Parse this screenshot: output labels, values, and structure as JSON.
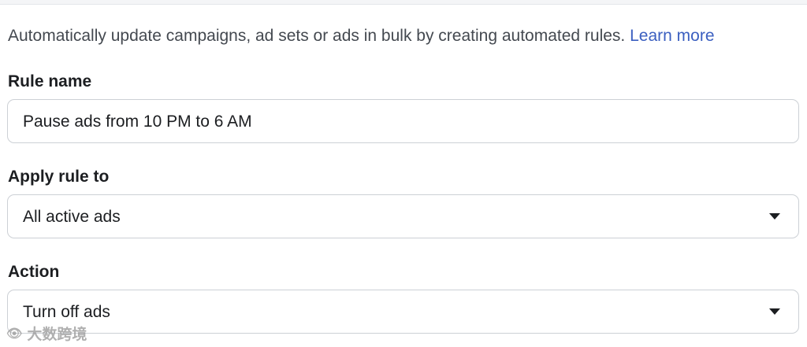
{
  "intro": {
    "text": "Automatically update campaigns, ad sets or ads in bulk by creating automated rules.",
    "link": "Learn more"
  },
  "rule_name": {
    "label": "Rule name",
    "value": "Pause ads from 10 PM to 6 AM"
  },
  "apply_rule_to": {
    "label": "Apply rule to",
    "selected": "All active ads"
  },
  "action": {
    "label": "Action",
    "selected": "Turn off ads"
  },
  "watermark": {
    "text": "大数跨境"
  },
  "colors": {
    "link": "#3b5fc0",
    "border": "#ccd0d5",
    "text": "#1c1e21"
  },
  "icons": [
    "dropdown-caret-icon",
    "watermark-logo-icon"
  ]
}
